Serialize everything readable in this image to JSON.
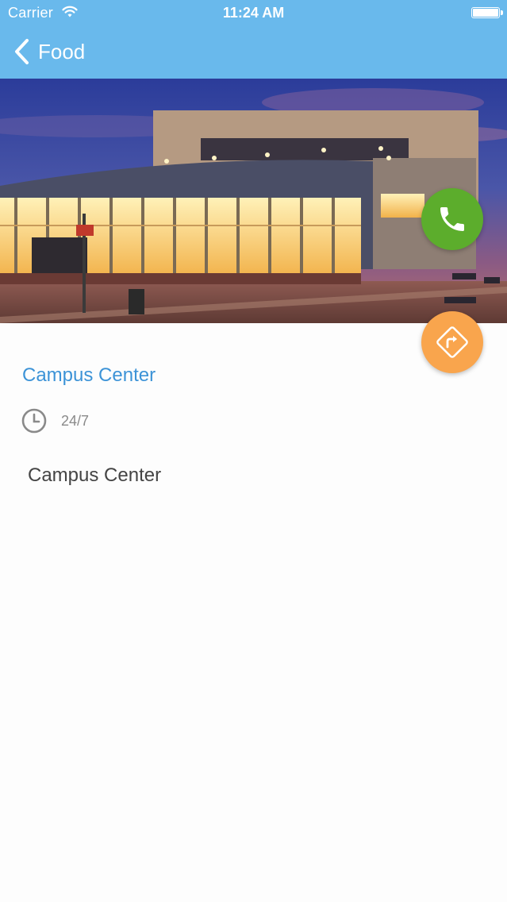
{
  "status_bar": {
    "carrier": "Carrier",
    "time": "11:24 AM"
  },
  "nav": {
    "back_label": "Food"
  },
  "place": {
    "title": "Campus Center",
    "hours": "24/7",
    "description": "Campus Center"
  },
  "icons": {
    "back": "chevron-left-icon",
    "call": "phone-icon",
    "directions": "directions-icon",
    "hours": "clock-icon"
  },
  "colors": {
    "nav_bar": "#69b9ec",
    "title": "#3c93d7",
    "call_button": "#5cad2c",
    "directions_button": "#f9a54d"
  }
}
